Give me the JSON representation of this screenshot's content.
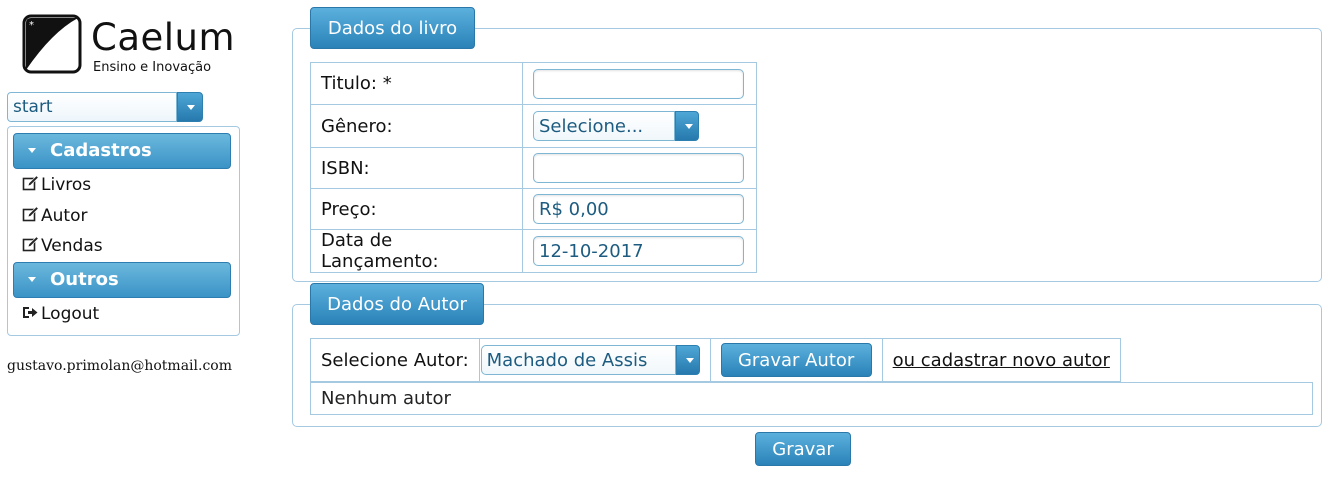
{
  "logo": {
    "name": "Caelum",
    "tagline": "Ensino e Inovação"
  },
  "theme": {
    "selected": "start"
  },
  "menu": {
    "sections": [
      {
        "title": "Cadastros",
        "items": [
          "Livros",
          "Autor",
          "Vendas"
        ]
      },
      {
        "title": "Outros",
        "items": [
          "Logout"
        ]
      }
    ]
  },
  "user": {
    "email": "gustavo.primolan@hotmail.com"
  },
  "livro": {
    "legend": "Dados do livro",
    "titulo_label": "Titulo: *",
    "titulo_value": "",
    "genero_label": "Gênero:",
    "genero_selected": "Selecione...",
    "isbn_label": "ISBN:",
    "isbn_value": "",
    "preco_label": "Preço:",
    "preco_value": "R$ 0,00",
    "data_label": "Data de Lançamento:",
    "data_value": "12-10-2017"
  },
  "autor": {
    "legend": "Dados do Autor",
    "select_label": "Selecione Autor:",
    "selected": "Machado de Assis",
    "gravar_autor": "Gravar Autor",
    "novo_autor_link": "ou cadastrar novo autor",
    "empty_message": "Nenhum autor"
  },
  "actions": {
    "gravar": "Gravar"
  },
  "colors": {
    "accent": "#3a93c6",
    "border": "#a6c9e2",
    "input_text": "#1d5c80"
  },
  "icons": {
    "livros": "edit-icon",
    "autor": "edit-icon",
    "vendas": "edit-icon",
    "logout": "sign-out-icon"
  }
}
